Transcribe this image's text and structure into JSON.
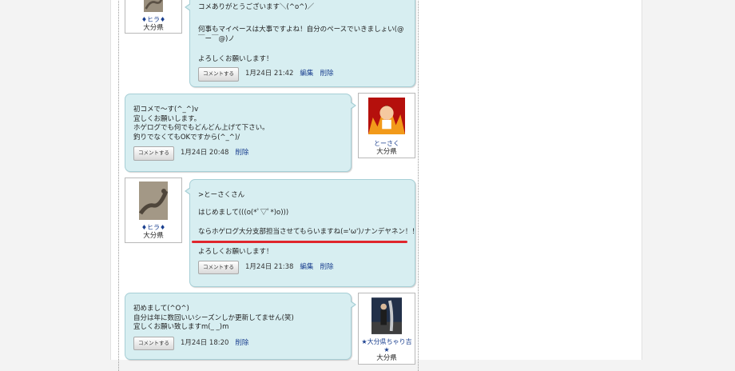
{
  "comments": [
    {
      "lines": [
        "コメありがとうございます＼(^o^)／",
        "",
        "何事もマイペースは大事ですよね！自分のペースでいきましょい(@",
        "￣ー￣@)ノ",
        "",
        "よろしくお願いします！"
      ],
      "button": "コメントする",
      "date": "1月24日 21:42",
      "edit": "編集",
      "delete": "削除"
    },
    {
      "lines": [
        "初コメで～す(^_^)v",
        "宜しくお願いします。",
        "ホゲログでも何でもどんどん上げて下さい。",
        "釣りでなくてもOKですから(^_^)/"
      ],
      "button": "コメントする",
      "date": "1月24日 20:48",
      "delete": "削除"
    },
    {
      "lines": [
        ">とーさくさん",
        "",
        "はじめまして(((o(*ﾟ▽ﾟ*)o)))",
        "",
        "ならホゲログ大分支部担当させてもらいますね(='ω')ﾉナンデヤネン！！",
        "",
        "よろしくお願いします！"
      ],
      "button": "コメントする",
      "date": "1月24日 21:38",
      "edit": "編集",
      "delete": "削除"
    },
    {
      "lines": [
        "初めまして(^O^)",
        "自分は年に数回いいシーズンしか更新してません(笑)",
        "宜しくお願い致しますm(_ _)m"
      ],
      "button": "コメントする",
      "date": "1月24日 18:20",
      "delete": "削除"
    }
  ],
  "users": [
    {
      "name": "♦ヒラ♦",
      "pref": "大分県",
      "icon": "lizard-avatar"
    },
    {
      "name": "とーさく",
      "pref": "大分県",
      "icon": "flame-character-avatar"
    },
    {
      "name": "♦ヒラ♦",
      "pref": "大分県",
      "icon": "lizard-avatar"
    },
    {
      "name": "★大分県ちゃり吉★",
      "pref": "大分県",
      "icon": "fisherman-photo-avatar"
    }
  ],
  "colors": {
    "bubble_bg": "#d7eef1",
    "bubble_border": "#a7cfd6",
    "link": "#1a3f8f",
    "underline": "#e0262c"
  }
}
